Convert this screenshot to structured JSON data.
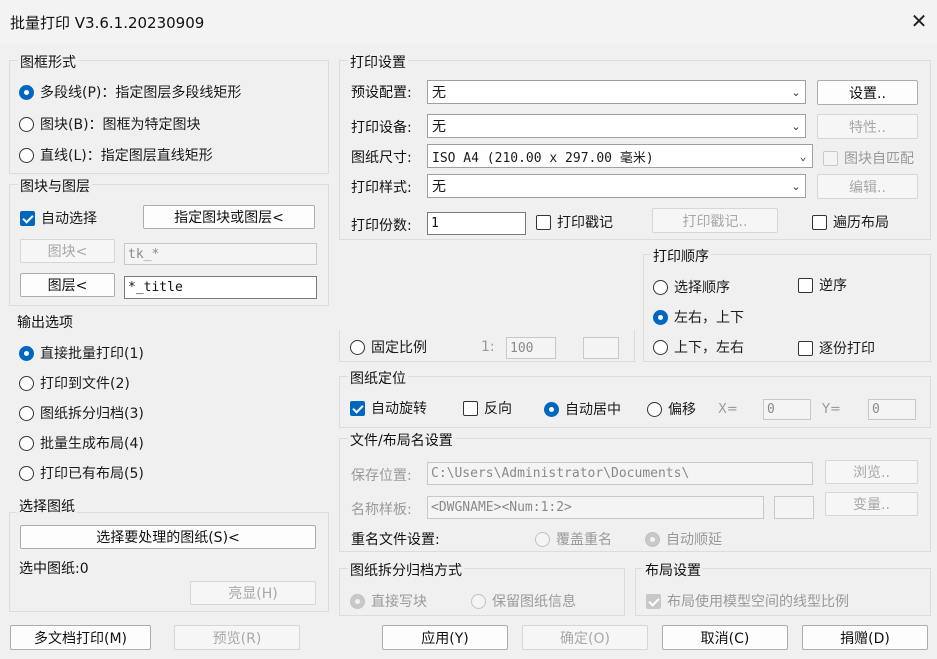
{
  "window": {
    "title": "批量打印 V3.6.1.20230909",
    "close_glyph": "✕"
  },
  "frame": {
    "label": "图框形式",
    "options": [
      {
        "label": "多段线(P)：指定图层多段线矩形",
        "selected": true
      },
      {
        "label": "图块(B)：图框为特定图块",
        "selected": false
      },
      {
        "label": "直线(L)：指定图层直线矩形",
        "selected": false
      }
    ]
  },
  "block_layer": {
    "label": "图块与图层",
    "auto_select": {
      "label": "自动选择",
      "checked": true
    },
    "specify_button": "指定图块或图层<",
    "block_button": "图块<",
    "block_value": "tk_*",
    "layer_button": "图层<",
    "layer_value": "*_title"
  },
  "output": {
    "label": "输出选项",
    "options": [
      {
        "label": "直接批量打印(1)",
        "selected": true
      },
      {
        "label": "打印到文件(2)",
        "selected": false
      },
      {
        "label": "图纸拆分归档(3)",
        "selected": false
      },
      {
        "label": "批量生成布局(4)",
        "selected": false
      },
      {
        "label": "打印已有布局(5)",
        "selected": false
      }
    ]
  },
  "select_sheets": {
    "label": "选择图纸",
    "select_button": "选择要处理的图纸(S)<",
    "selected_count": "选中图纸:0",
    "highlight_button": "亮显(H)"
  },
  "print_settings": {
    "label": "打印设置",
    "preset_label": "预设配置:",
    "preset_value": "无",
    "setup_button": "设置..",
    "device_label": "打印设备:",
    "device_value": "无",
    "properties_button": "特性..",
    "paper_label": "图纸尺寸:",
    "paper_value": "ISO A4 (210.00 x 297.00 毫米)",
    "auto_fit": {
      "label": "图块自匹配",
      "checked": false
    },
    "style_label": "打印样式:",
    "style_value": "无",
    "edit_button": "编辑..",
    "copies_label": "打印份数:",
    "copies_value": "1",
    "stamp": {
      "label": "打印戳记",
      "checked": false
    },
    "stamp_button": "打印戳记..",
    "traverse": {
      "label": "遍历布局",
      "checked": false
    }
  },
  "scale": {
    "fixed_label": "固定比例",
    "ratio_prefix": "1:",
    "ratio_value": "100"
  },
  "order": {
    "label": "打印顺序",
    "select_order": "选择顺序",
    "reverse": "逆序",
    "lr_tb": "左右，上下",
    "tb_lr": "上下，左右",
    "by_copy": "逐份打印"
  },
  "position": {
    "label": "图纸定位",
    "auto_rotate": "自动旋转",
    "reverse": "反向",
    "auto_center": "自动居中",
    "offset": "偏移",
    "x_label": "X=",
    "x_value": "0",
    "y_label": "Y=",
    "y_value": "0"
  },
  "file_name": {
    "label": "文件/布局名设置",
    "save_label": "保存位置:",
    "save_value": "C:\\Users\\Administrator\\Documents\\",
    "browse_button": "浏览..",
    "template_label": "名称样板:",
    "template_value": "<DWGNAME><Num:1:2>",
    "variable_button": "变量..",
    "rename_label": "重名文件设置:",
    "overwrite": "覆盖重名",
    "auto_increment": "自动顺延"
  },
  "split": {
    "label": "图纸拆分归档方式",
    "direct_write": "直接写块",
    "keep_info": "保留图纸信息"
  },
  "layout": {
    "label": "布局设置",
    "model_scale": "布局使用模型空间的线型比例"
  },
  "footer": {
    "multi_doc": "多文档打印(M)",
    "preview": "预览(R)",
    "apply": "应用(Y)",
    "ok": "确定(O)",
    "cancel": "取消(C)",
    "donate": "捐赠(D)"
  }
}
